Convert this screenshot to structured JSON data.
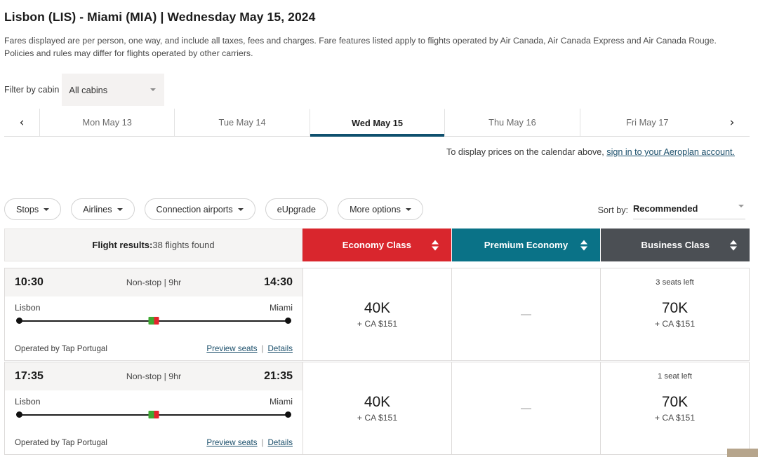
{
  "header": {
    "route": "Lisbon (LIS) - Miami (MIA)",
    "separator": "|",
    "date": "Wednesday May 15, 2024",
    "note": "Fares displayed are per person, one way, and include all taxes, fees and charges. Fare features listed apply to flights operated by Air Canada, Air Canada Express and Air Canada Rouge. Policies and rules may differ for flights operated by other carriers."
  },
  "cabin_filter": {
    "label": "Filter by cabin",
    "value": "All cabins",
    "caret_icon": "chevron-down-icon"
  },
  "date_tabs": {
    "prev_icon": "chevron-left-icon",
    "next_icon": "chevron-right-icon",
    "items": [
      {
        "label": "Mon May 13",
        "active": false
      },
      {
        "label": "Tue May 14",
        "active": false
      },
      {
        "label": "Wed May 15",
        "active": true
      },
      {
        "label": "Thu May 16",
        "active": false
      },
      {
        "label": "Fri May 17",
        "active": false
      }
    ],
    "active_underline_color": "#0f506e"
  },
  "signin": {
    "prefix": "To display prices on the calendar above, ",
    "link": "sign in to your Aeroplan account."
  },
  "filters": {
    "pills": [
      {
        "label": "Stops",
        "caret": true
      },
      {
        "label": "Airlines",
        "caret": true
      },
      {
        "label": "Connection airports",
        "caret": true
      },
      {
        "label": "eUpgrade",
        "caret": false
      },
      {
        "label": "More options",
        "caret": true
      }
    ]
  },
  "sort": {
    "label": "Sort by:",
    "value": "Recommended",
    "caret_icon": "chevron-down-icon"
  },
  "results": {
    "summary_label": "Flight results:",
    "summary_count": "38 flights found",
    "classes": [
      {
        "label": "Economy Class",
        "color": "#d9262d"
      },
      {
        "label": "Premium Economy",
        "color": "#0a7287"
      },
      {
        "label": "Business Class",
        "color": "#4b4f54"
      }
    ]
  },
  "flights": [
    {
      "depart_time": "10:30",
      "arrive_time": "14:30",
      "stops_duration": "Non-stop | 9hr",
      "origin_city": "Lisbon",
      "destination_city": "Miami",
      "operated_by": "Operated by Tap Portugal",
      "preview_seats": "Preview seats",
      "divider": "|",
      "details": "Details",
      "fares": [
        {
          "seats": "",
          "points": "40K",
          "cash": "+ CA $151",
          "unavailable": false
        },
        {
          "seats": "",
          "points": "",
          "cash": "",
          "unavailable": true
        },
        {
          "seats": "3 seats left",
          "points": "70K",
          "cash": "+ CA $151",
          "unavailable": false
        }
      ]
    },
    {
      "depart_time": "17:35",
      "arrive_time": "21:35",
      "stops_duration": "Non-stop | 9hr",
      "origin_city": "Lisbon",
      "destination_city": "Miami",
      "operated_by": "Operated by Tap Portugal",
      "preview_seats": "Preview seats",
      "divider": "|",
      "details": "Details",
      "fares": [
        {
          "seats": "",
          "points": "40K",
          "cash": "+ CA $151",
          "unavailable": false
        },
        {
          "seats": "",
          "points": "",
          "cash": "",
          "unavailable": true
        },
        {
          "seats": "1 seat left",
          "points": "70K",
          "cash": "+ CA $151",
          "unavailable": false
        }
      ]
    }
  ],
  "unavailable_glyph": "—",
  "carrier_logo": "tap-portugal-logo-icon"
}
